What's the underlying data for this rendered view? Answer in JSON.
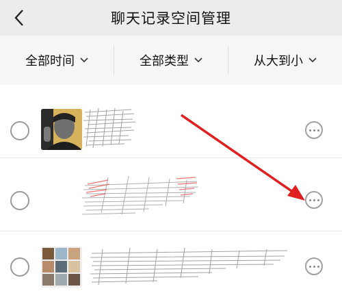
{
  "header": {
    "title": "聊天记录空间管理",
    "back_icon": "chevron-left-icon"
  },
  "filters": [
    {
      "label": "全部时间"
    },
    {
      "label": "全部类型"
    },
    {
      "label": "从大到小"
    }
  ],
  "colors": {
    "arrow": "#e02020",
    "header_bg": "#ececec",
    "filter_bg": "#f6f6f6"
  }
}
